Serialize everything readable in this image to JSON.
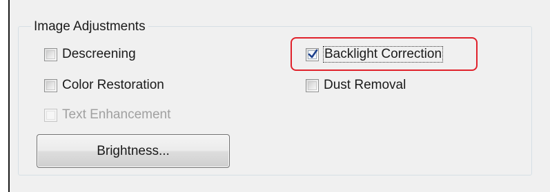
{
  "group": {
    "title": "Image Adjustments"
  },
  "options": {
    "descreening": {
      "label": "Descreening",
      "checked": false,
      "enabled": true
    },
    "color_restoration": {
      "label": "Color Restoration",
      "checked": false,
      "enabled": true
    },
    "text_enhancement": {
      "label": "Text Enhancement",
      "checked": false,
      "enabled": false
    },
    "backlight_correction": {
      "label": "Backlight Correction",
      "checked": true,
      "enabled": true
    },
    "dust_removal": {
      "label": "Dust Removal",
      "checked": false,
      "enabled": true
    }
  },
  "buttons": {
    "brightness": "Brightness..."
  },
  "colors": {
    "highlight": "#e0202a",
    "checkmark": "#1b3f8c"
  }
}
